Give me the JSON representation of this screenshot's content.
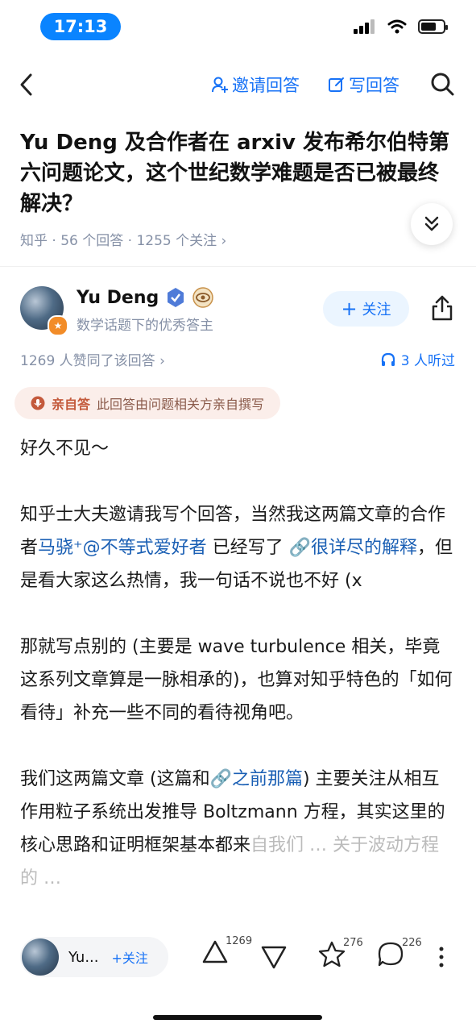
{
  "status_bar": {
    "time": "17:13"
  },
  "nav": {
    "invite_label": "邀请回答",
    "write_label": "写回答"
  },
  "question": {
    "title": "Yu Deng 及合作者在 arxiv 发布希尔伯特第六问题论文，这个世纪数学难题是否已被最终解决？",
    "meta": "知乎 · 56 个回答 · 1255 个关注 ›"
  },
  "author": {
    "name": "Yu Deng",
    "description": "数学话题下的优秀答主",
    "follow_label": "关注",
    "likes_text": "1269 人赞同了该回答 ›",
    "listen_text": "3 人听过"
  },
  "self_answer_tag": {
    "title": "亲自答",
    "text": "此回答由问题相关方亲自撰写"
  },
  "content": {
    "p1": "好久不见～",
    "p2_a": "知乎士大夫邀请我写个回答，当然我这两篇文章的合作者",
    "p2_link1": "马骁⁺@不等式爱好者",
    "p2_b": " 已经写了 ",
    "p2_link2": "🔗很详尽的解释",
    "p2_c": "，但是看大家这么热情，我一句话不说也不好 (x",
    "p3": "那就写点别的 (主要是 wave turbulence 相关，毕竟这系列文章算是一脉相承的)，也算对知乎特色的「如何看待」补充一些不同的看待视角吧。",
    "p4_a": "我们这两篇文章 (这篇和",
    "p4_link": "🔗之前那篇",
    "p4_b": ") 主要关注从相互作用粒子系统出发推导 Boltzmann 方程，其实这里的核心思路和证明框架基本都来",
    "p5": "自我们 … 关于波动方程的 …"
  },
  "bottom_bar": {
    "author_short": "Yu...",
    "follow_label": "+关注",
    "upvotes": "1269",
    "favorites": "276",
    "comments": "226"
  },
  "colors": {
    "accent": "#1772f6",
    "time_pill": "#0a84ff"
  }
}
